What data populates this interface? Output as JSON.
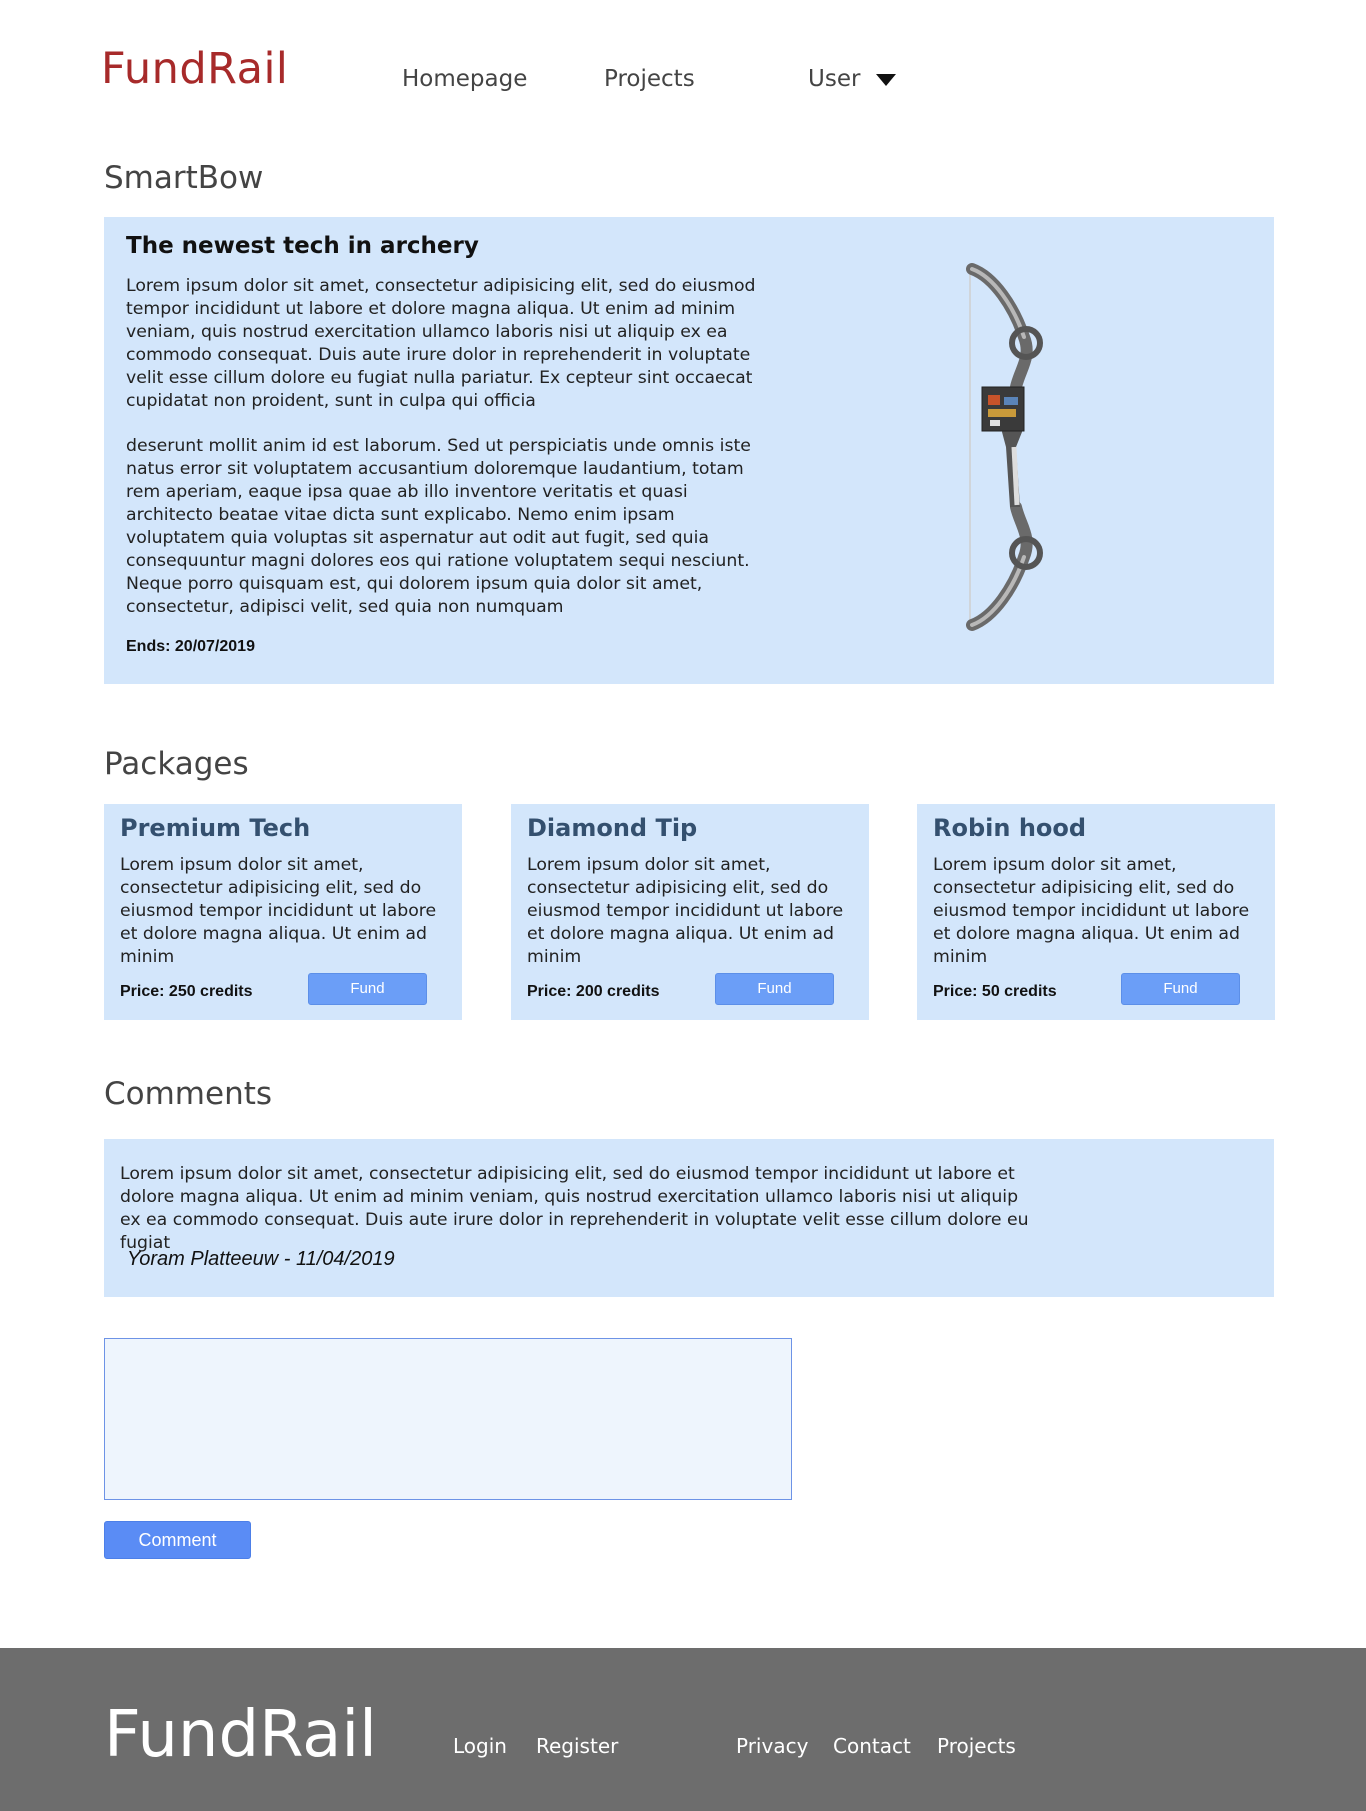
{
  "header": {
    "logo": "FundRail",
    "nav": {
      "homepage": "Homepage",
      "projects": "Projects",
      "user": "User"
    }
  },
  "project": {
    "title": "SmartBow",
    "heading": "The newest tech in archery",
    "paragraphs": [
      "Lorem ipsum dolor sit amet, consectetur adipisicing elit, sed do eiusmod tempor incididunt ut labore et dolore magna aliqua. Ut enim ad minim veniam, quis nostrud exercitation ullamco laboris nisi ut aliquip ex ea commodo consequat. Duis aute irure dolor in reprehenderit in voluptate velit esse cillum dolore eu fugiat nulla pariatur. Ex cepteur sint occaecat cupidatat non proident, sunt in culpa qui officia",
      "deserunt mollit anim id est laborum. Sed ut perspiciatis unde omnis iste natus error sit voluptatem accusantium doloremque laudantium, totam rem aperiam, eaque ipsa quae ab illo inventore veritatis et quasi architecto beatae vitae dicta sunt explicabo. Nemo enim ipsam voluptatem quia voluptas sit aspernatur aut odit aut fugit, sed quia consequuntur magni dolores eos qui ratione voluptatem sequi nesciunt. Neque porro quisquam est, qui dolorem ipsum quia dolor sit amet, consectetur, adipisci velit, sed quia non numquam"
    ],
    "ends": "Ends: 20/07/2019"
  },
  "packages": {
    "title": "Packages",
    "items": [
      {
        "name": "Premium Tech",
        "description": "Lorem ipsum dolor sit amet, consectetur adipisicing elit, sed do eiusmod tempor incididunt ut labore et dolore magna aliqua. Ut enim ad minim",
        "price": "Price: 250 credits",
        "button": "Fund"
      },
      {
        "name": "Diamond Tip",
        "description": "Lorem ipsum dolor sit amet, consectetur adipisicing elit, sed do eiusmod tempor incididunt ut labore et dolore magna aliqua. Ut enim ad minim",
        "price": "Price: 200 credits",
        "button": "Fund"
      },
      {
        "name": "Robin hood",
        "description": "Lorem ipsum dolor sit amet, consectetur adipisicing elit, sed do eiusmod tempor incididunt ut labore et dolore magna aliqua. Ut enim ad minim",
        "price": "Price: 50 credits",
        "button": "Fund"
      }
    ]
  },
  "comments": {
    "title": "Comments",
    "items": [
      {
        "text": "Lorem ipsum dolor sit amet, consectetur adipisicing elit, sed do eiusmod tempor incididunt ut labore et dolore magna aliqua. Ut enim ad minim veniam, quis nostrud exercitation ullamco laboris nisi ut aliquip ex ea commodo consequat. Duis aute irure dolor in reprehenderit in voluptate velit esse cillum dolore eu fugiat",
        "author": "Yoram Platteeuw - 11/04/2019"
      }
    ],
    "input_value": "",
    "submit_label": "Comment"
  },
  "footer": {
    "logo": "FundRail",
    "links": {
      "login": "Login",
      "register": "Register",
      "privacy": "Privacy",
      "contact": "Contact",
      "projects": "Projects"
    }
  },
  "colors": {
    "brand": "#a72a2a",
    "panel": "#d3e6fb",
    "button": "#6b9ef7",
    "footer": "#6d6d6d"
  }
}
